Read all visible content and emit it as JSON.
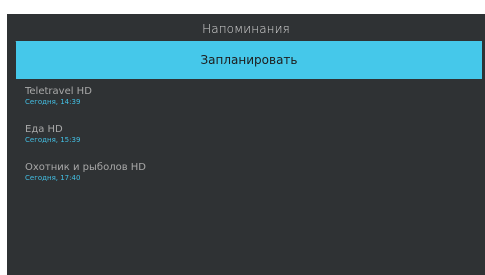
{
  "header": {
    "title": "Напоминания"
  },
  "actions": {
    "schedule_label": "Запланировать"
  },
  "reminders": [
    {
      "name": "Teletravel HD",
      "time": "Сегодня, 14:39"
    },
    {
      "name": "Еда HD",
      "time": "Сегодня, 15:39"
    },
    {
      "name": "Охотник и рыболов HD",
      "time": "Сегодня, 17:40"
    }
  ],
  "colors": {
    "background": "#2f3234",
    "accent": "#45c8ea",
    "time_text": "#43bfe3",
    "name_text": "#a9a9a9"
  }
}
